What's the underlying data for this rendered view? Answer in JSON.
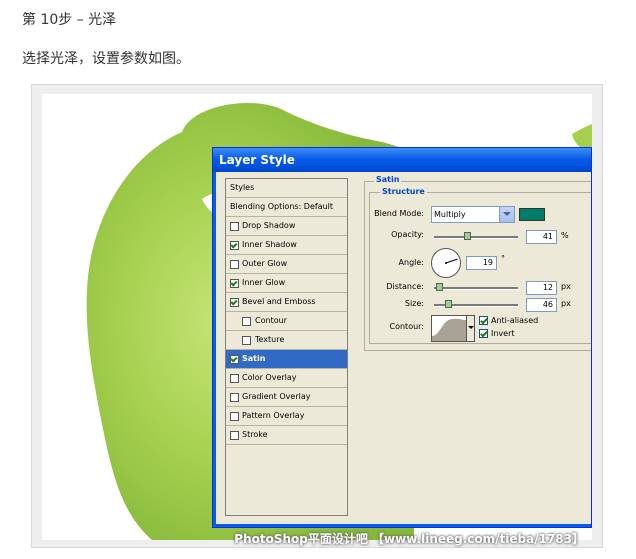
{
  "step_title": "第 10步 – 光泽",
  "instruction": "选择光泽，设置参数如图。",
  "watermark": "PhotoShop平面设计吧 【www.lineeg.com/tieba/1783】",
  "colors": {
    "shape_green": "#9fcc4e",
    "title_blue": "#0054e3",
    "selected_row": "#316ac5",
    "satin_color": "#007d6a",
    "panel_bg": "#ece9d8"
  },
  "dialog": {
    "title": "Layer Style",
    "styles_list": [
      {
        "label": "Styles",
        "checkbox": false,
        "checked": false,
        "indent": false,
        "selected": false
      },
      {
        "label": "Blending Options: Default",
        "checkbox": false,
        "checked": false,
        "indent": false,
        "selected": false
      },
      {
        "label": "Drop Shadow",
        "checkbox": true,
        "checked": false,
        "indent": false,
        "selected": false
      },
      {
        "label": "Inner Shadow",
        "checkbox": true,
        "checked": true,
        "indent": false,
        "selected": false
      },
      {
        "label": "Outer Glow",
        "checkbox": true,
        "checked": false,
        "indent": false,
        "selected": false
      },
      {
        "label": "Inner Glow",
        "checkbox": true,
        "checked": true,
        "indent": false,
        "selected": false
      },
      {
        "label": "Bevel and Emboss",
        "checkbox": true,
        "checked": true,
        "indent": false,
        "selected": false
      },
      {
        "label": "Contour",
        "checkbox": true,
        "checked": false,
        "indent": true,
        "selected": false
      },
      {
        "label": "Texture",
        "checkbox": true,
        "checked": false,
        "indent": true,
        "selected": false
      },
      {
        "label": "Satin",
        "checkbox": true,
        "checked": true,
        "indent": false,
        "selected": true
      },
      {
        "label": "Color Overlay",
        "checkbox": true,
        "checked": false,
        "indent": false,
        "selected": false
      },
      {
        "label": "Gradient Overlay",
        "checkbox": true,
        "checked": false,
        "indent": false,
        "selected": false
      },
      {
        "label": "Pattern Overlay",
        "checkbox": true,
        "checked": false,
        "indent": false,
        "selected": false
      },
      {
        "label": "Stroke",
        "checkbox": true,
        "checked": false,
        "indent": false,
        "selected": false
      }
    ],
    "satin": {
      "group_label": "Satin",
      "structure_label": "Structure",
      "blend_mode_label": "Blend Mode:",
      "blend_mode_value": "Multiply",
      "opacity_label": "Opacity:",
      "opacity_value": "41",
      "opacity_unit": "%",
      "opacity_level": 0.41,
      "angle_label": "Angle:",
      "angle_value": "19",
      "angle_unit": "°",
      "distance_label": "Distance:",
      "distance_value": "12",
      "distance_unit": "px",
      "distance_level": 0.06,
      "size_label": "Size:",
      "size_value": "46",
      "size_unit": "px",
      "size_level": 0.18,
      "contour_label": "Contour:",
      "anti_aliased_label": "Anti-aliased",
      "anti_aliased_checked": true,
      "invert_label": "Invert",
      "invert_checked": true
    }
  }
}
